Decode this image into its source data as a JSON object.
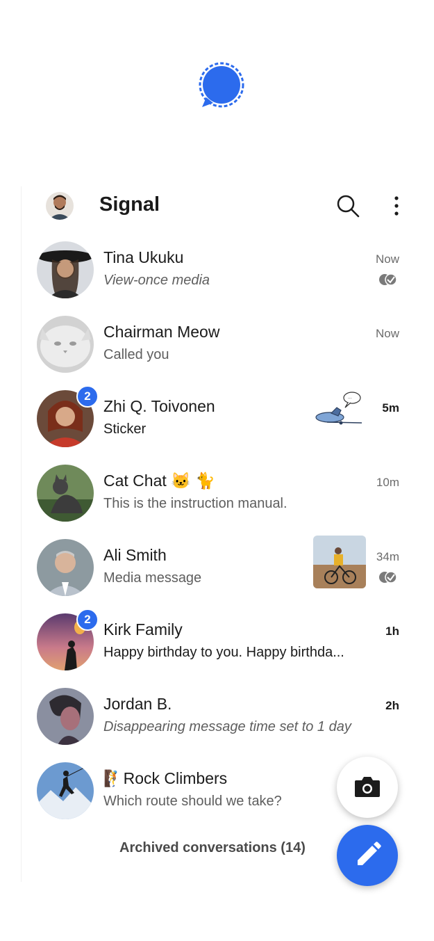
{
  "app": {
    "title": "Signal"
  },
  "icons": {
    "logo": "signal-logo-icon",
    "search": "search-icon",
    "menu": "more-vert-icon",
    "camera": "camera-icon",
    "compose": "pencil-icon",
    "read_receipt": "read-receipt-icon"
  },
  "colors": {
    "accent": "#2c6bed"
  },
  "conversations": [
    {
      "name": "Tina Ukuku",
      "snippet": "View-once media",
      "time": "Now",
      "unread": "",
      "read_receipt": true
    },
    {
      "name": "Chairman Meow",
      "snippet": "Called you",
      "time": "Now",
      "unread": ""
    },
    {
      "name": "Zhi Q. Toivonen",
      "snippet": "Sticker",
      "time": "5m",
      "unread": "2"
    },
    {
      "name": "Cat Chat 🐱 🐈",
      "snippet": "This is the instruction manual.",
      "time": "10m",
      "unread": ""
    },
    {
      "name": "Ali Smith",
      "snippet": "Media message",
      "time": "34m",
      "unread": "",
      "read_receipt": true
    },
    {
      "name": "Kirk Family",
      "snippet": "Happy birthday to you. Happy birthda...",
      "time": "1h",
      "unread": "2"
    },
    {
      "name": "Jordan B.",
      "snippet": "Disappearing message time set to 1 day",
      "time": "2h",
      "unread": ""
    },
    {
      "name": "🧗Rock Climbers",
      "snippet": "Which route should we take?",
      "time": "",
      "unread": ""
    }
  ],
  "archived": {
    "label": "Archived conversations (14)"
  }
}
